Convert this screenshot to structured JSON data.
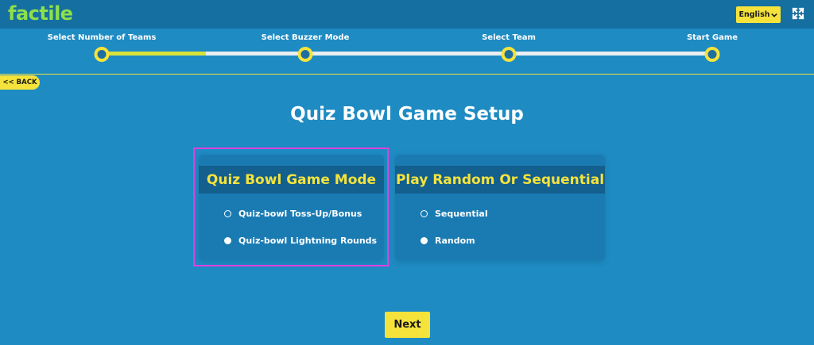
{
  "header": {
    "logo": "factile",
    "language": "English",
    "icons": {
      "language_dropdown": "chevron-down-icon",
      "fullscreen": "expand-icon"
    }
  },
  "stepper": {
    "steps": [
      {
        "label": "Select Number of Teams"
      },
      {
        "label": "Select Buzzer Mode"
      },
      {
        "label": "Select Team"
      },
      {
        "label": "Start Game"
      }
    ],
    "progress_fraction": 0.17
  },
  "back_label": "<< BACK",
  "page_title": "Quiz Bowl Game Setup",
  "panels": [
    {
      "title": "Quiz Bowl Game Mode",
      "options": [
        {
          "label": "Quiz-bowl Toss-Up/Bonus",
          "selected": false
        },
        {
          "label": "Quiz-bowl Lightning Rounds",
          "selected": true
        }
      ]
    },
    {
      "title": "Play Random Or Sequential",
      "options": [
        {
          "label": "Sequential",
          "selected": false
        },
        {
          "label": "Random",
          "selected": true
        }
      ]
    }
  ],
  "next_label": "Next",
  "colors": {
    "background": "#1e8bc3",
    "header": "#156fa0",
    "accent_yellow": "#f5e33b",
    "logo_green": "#8ee04a",
    "highlight_magenta": "#e040e0"
  }
}
